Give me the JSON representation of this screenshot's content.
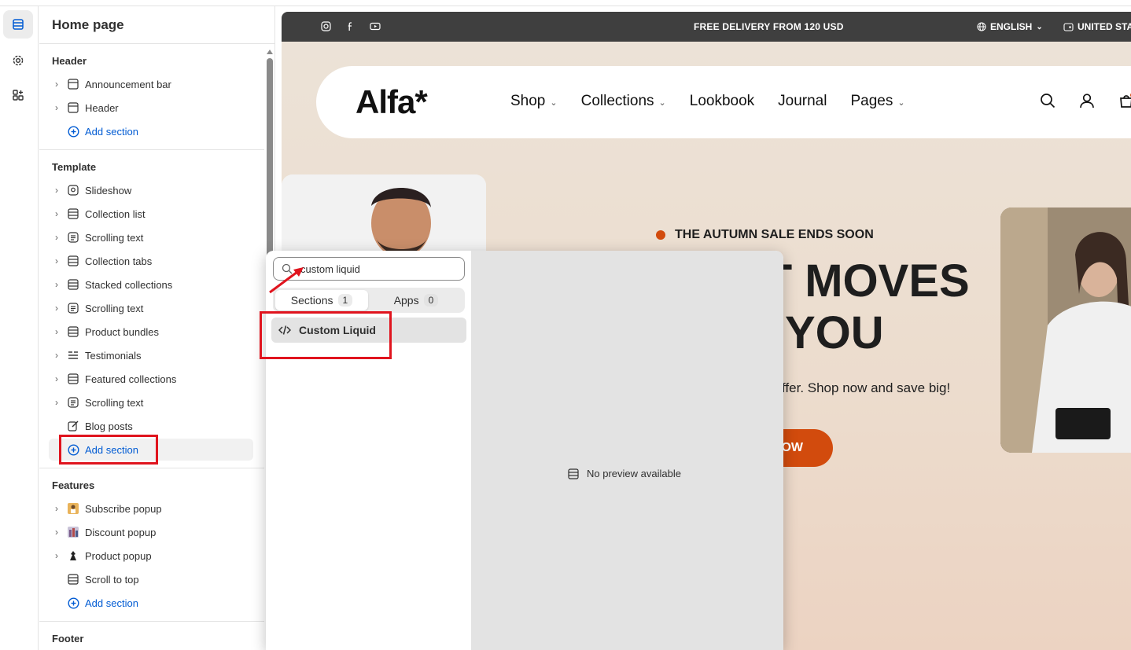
{
  "sidebar": {
    "title": "Home page",
    "groups": {
      "header": {
        "title": "Header",
        "items": [
          "Announcement bar",
          "Header"
        ],
        "add_label": "Add section"
      },
      "template": {
        "title": "Template",
        "items": [
          "Slideshow",
          "Collection list",
          "Scrolling text",
          "Collection tabs",
          "Stacked collections",
          "Scrolling text",
          "Product bundles",
          "Testimonials",
          "Featured collections",
          "Scrolling text",
          "Blog posts"
        ],
        "add_label": "Add section"
      },
      "features": {
        "title": "Features",
        "items": [
          "Subscribe popup",
          "Discount popup",
          "Product popup",
          "Scroll to top"
        ],
        "add_label": "Add section"
      },
      "footer": {
        "title": "Footer"
      }
    }
  },
  "picker": {
    "search_value": "custom liquid",
    "tabs": [
      {
        "label": "Sections",
        "count": "1"
      },
      {
        "label": "Apps",
        "count": "0"
      }
    ],
    "result": "Custom Liquid",
    "no_preview": "No preview available"
  },
  "store": {
    "announcement": "FREE DELIVERY FROM 120 USD",
    "language": "ENGLISH",
    "country": "UNITED STA",
    "logo": "Alfa*",
    "menu": [
      "Shop",
      "Collections",
      "Lookbook",
      "Journal",
      "Pages"
    ],
    "sale_tag": "THE AUTUMN SALE ENDS SOON",
    "hero_line1": "IAT MOVES",
    "hero_line2": "YOU",
    "hero_sub": "ffer. Shop now and save big!",
    "hero_button": "OW",
    "accent": "#d24b0d"
  },
  "colors": {
    "link": "#005bd3",
    "annotation": "#e0141e"
  }
}
